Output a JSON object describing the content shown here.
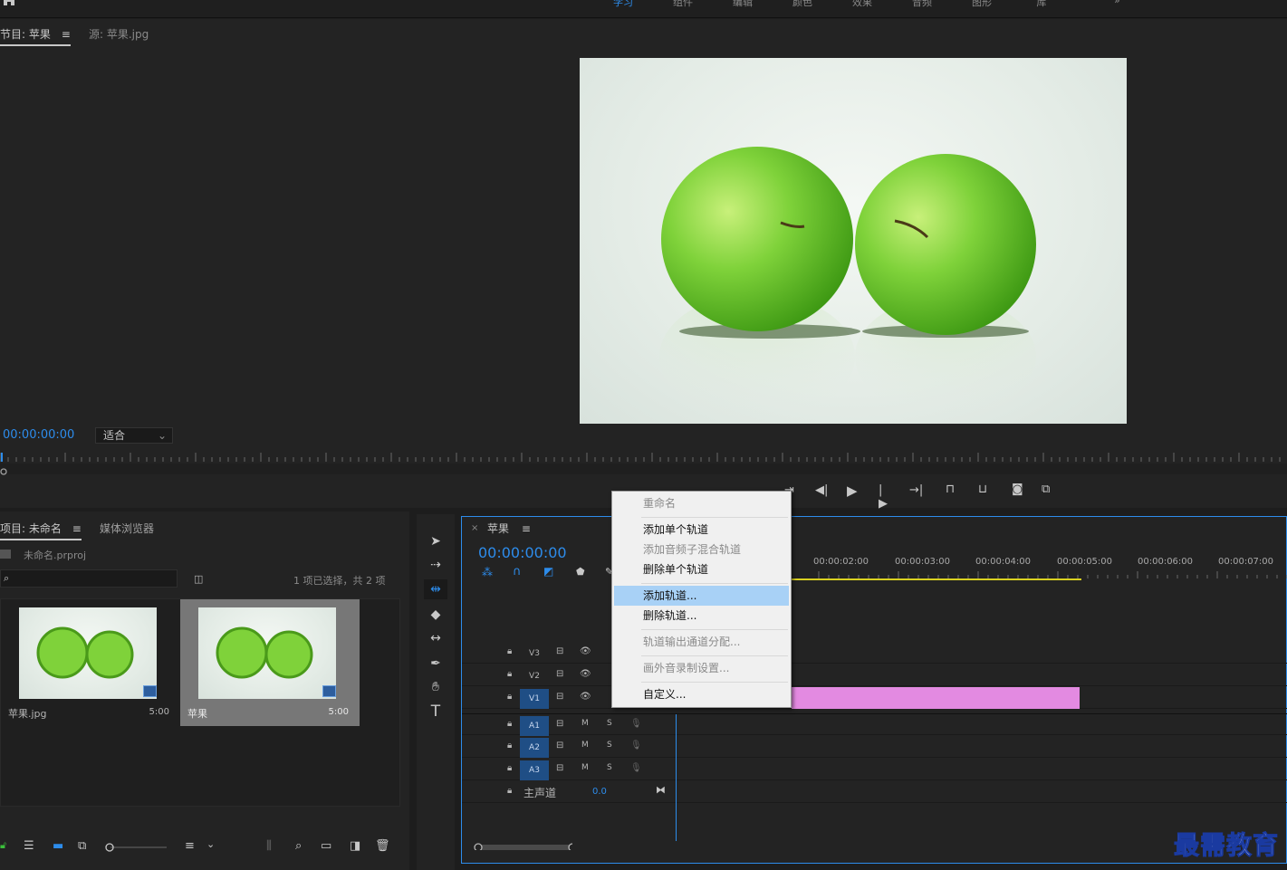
{
  "workspace_tabs": [
    "学习",
    "组件",
    "编辑",
    "颜色",
    "效果",
    "音频",
    "图形",
    "库"
  ],
  "program_monitor": {
    "tab_program": "节目: 苹果",
    "tab_source": "源: 苹果.jpg",
    "timecode": "00:00:00:00",
    "fit_label": "适合"
  },
  "project_panel": {
    "tab_project": "项目: 未命名",
    "tab_media_browser": "媒体浏览器",
    "project_file": "未命名.prproj",
    "selection_count": "1 项已选择，共 2 项",
    "clips": [
      {
        "name": "苹果.jpg",
        "duration": "5:00"
      },
      {
        "name": "苹果",
        "duration": "5:00"
      }
    ]
  },
  "timeline": {
    "sequence_name": "苹果",
    "timecode": "00:00:00:00",
    "ruler_labels": [
      "00:00:02:00",
      "00:00:03:00",
      "00:00:04:00",
      "00:00:05:00",
      "00:00:06:00",
      "00:00:07:00"
    ],
    "video_tracks": [
      "V3",
      "V2",
      "V1"
    ],
    "audio_tracks": [
      "A1",
      "A2",
      "A3"
    ],
    "audio_mute": "M",
    "audio_solo": "S",
    "master_label": "主声道",
    "master_value": "0.0"
  },
  "context_menu": {
    "rename": "重命名",
    "add_single_track": "添加单个轨道",
    "add_submix_track": "添加音频子混合轨道",
    "delete_single_track": "删除单个轨道",
    "add_tracks": "添加轨道...",
    "delete_tracks": "删除轨道...",
    "track_output_channel": "轨道输出通道分配...",
    "voiceover_settings": "画外音录制设置...",
    "customize": "自定义..."
  },
  "watermark": "最需教育",
  "colors": {
    "accent": "#2d8ceb",
    "clip_pink": "#e38ae1",
    "menu_highlight": "#a8d1f6"
  }
}
